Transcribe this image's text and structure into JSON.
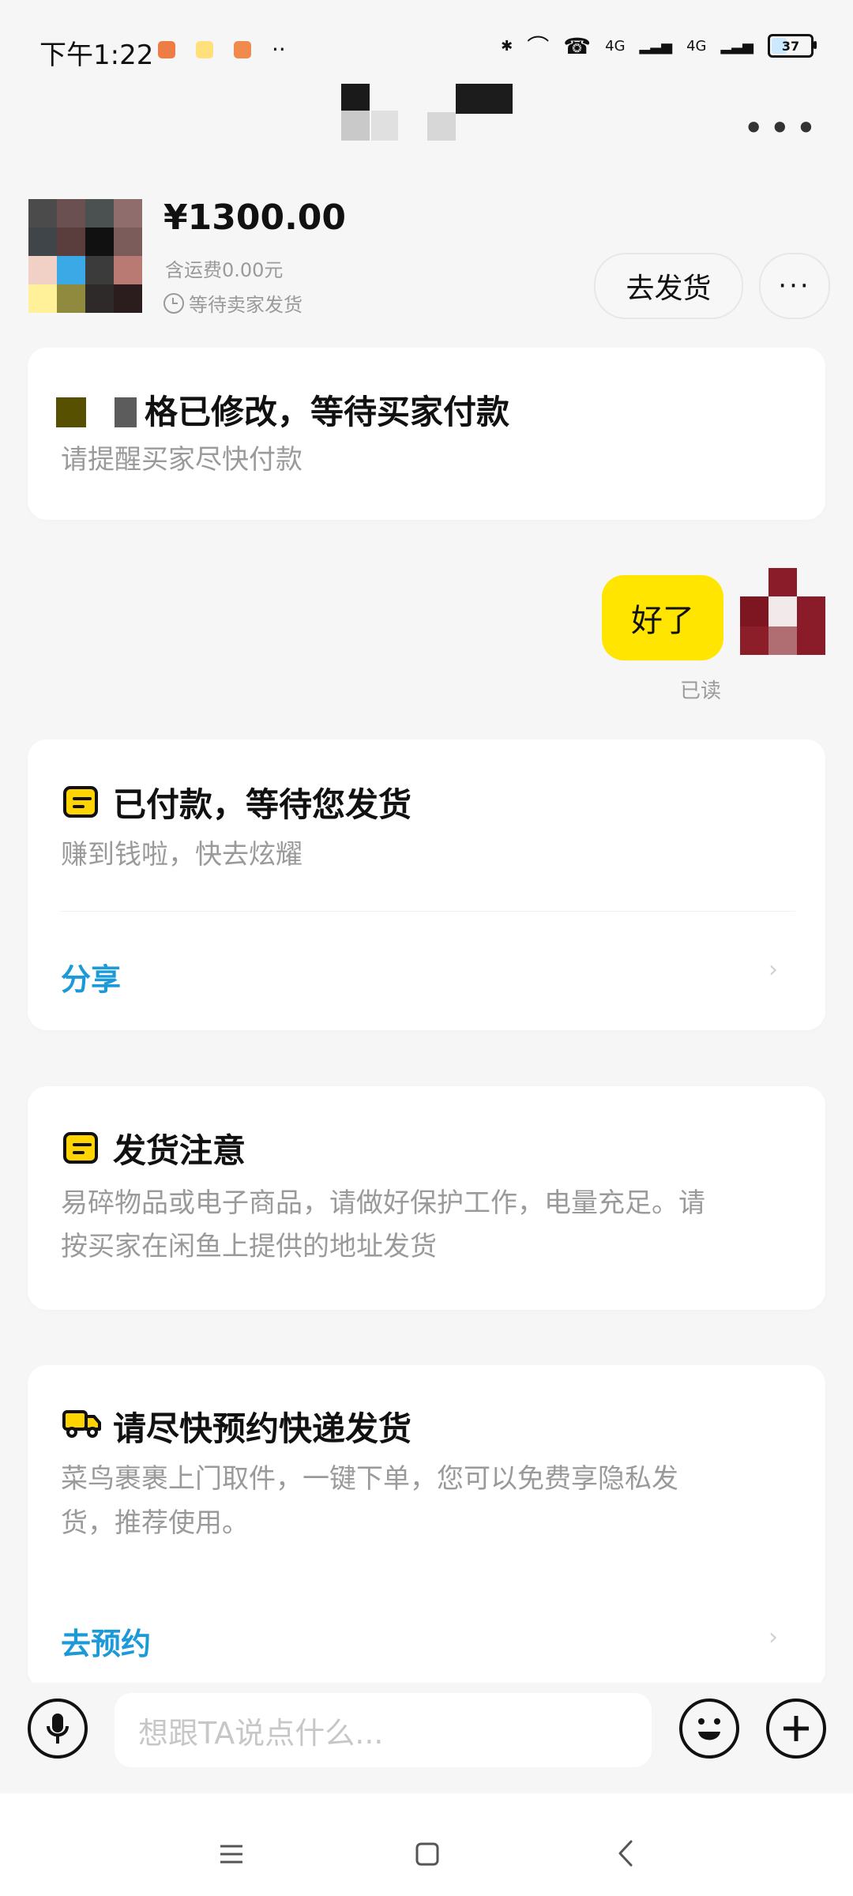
{
  "status_bar": {
    "time": "下午1:22",
    "signal_label_1": "4G",
    "signal_label_2": "4G",
    "battery": "37",
    "battery_level": 0.37
  },
  "product": {
    "price": "¥1300.00",
    "shipping": "含运费0.00元",
    "status": "等待卖家发货",
    "ship_button": "去发货",
    "more_button": "···"
  },
  "notice": {
    "title": "格已修改，等待买家付款",
    "subtitle": "请提醒买家尽快付款"
  },
  "message": {
    "text": "好了",
    "read_status": "已读"
  },
  "payment_card": {
    "title": "已付款，等待您发货",
    "subtitle": "赚到钱啦，快去炫耀",
    "action": "分享"
  },
  "shipping_notice": {
    "title": "发货注意",
    "line1": "易碎物品或电子商品，请做好保护工作，电量充足。请",
    "line2": "按买家在闲鱼上提供的地址发货"
  },
  "courier_card": {
    "title": "请尽快预约快递发货",
    "line1": "菜鸟裹裹上门取件，一键下单，您可以免费享隐私发",
    "line2": "货，推荐使用。",
    "action": "去预约"
  },
  "input": {
    "placeholder": "想跟TA说点什么..."
  },
  "colors": {
    "accent_yellow": "#ffe500",
    "link_blue": "#1c9ad7"
  }
}
